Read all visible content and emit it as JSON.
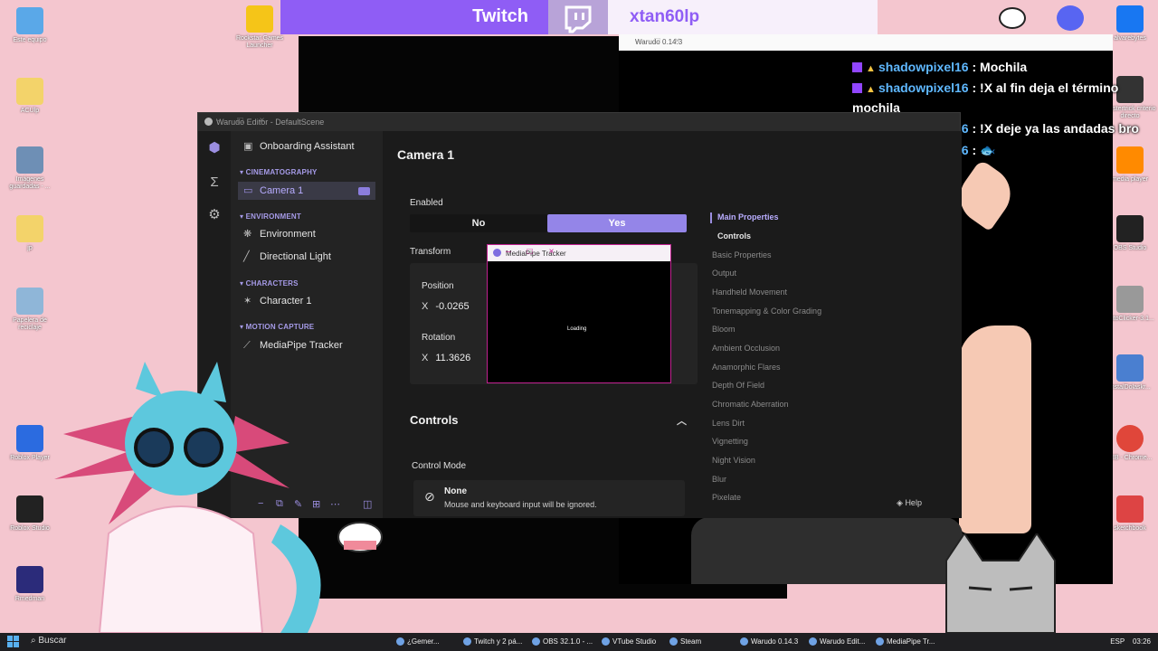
{
  "desktop": {
    "icons": [
      {
        "label": "Este equipo",
        "color": "#5aa8e8"
      },
      {
        "label": "ACUlp",
        "color": "#f3d36a"
      },
      {
        "label": "Imágenes guardadas - ...",
        "color": "#6e8fb5"
      },
      {
        "label": "jp",
        "color": "#f3d36a"
      },
      {
        "label": "Papelera de reciclaje",
        "color": "#8fb6d8"
      },
      {
        "label": "Roblox Player",
        "color": "#2b6be0"
      },
      {
        "label": "Roblox Studio",
        "color": "#222222"
      },
      {
        "label": "Rmedman",
        "color": "#2b2b7a"
      },
      {
        "label": "Rockstar Games Launcher",
        "color": "#f5c518"
      }
    ],
    "right_icons": [
      {
        "label": "alvarebytes",
        "color": "#1877f2"
      },
      {
        "label": "Mastertrick criterio directo",
        "color": "#333"
      },
      {
        "label": "media player",
        "color": "#ff8a00"
      },
      {
        "label": "OBS Studio",
        "color": "#222"
      },
      {
        "label": "AutoClicker-3.1...",
        "color": "#999"
      },
      {
        "label": "instalDolaskr...",
        "color": "#4a7fd0"
      },
      {
        "label": "GIB - Chrome...",
        "color": "#e0463a"
      },
      {
        "label": "sketchbook",
        "color": "#d44"
      }
    ]
  },
  "twitch_banner": {
    "brand": "Twitch",
    "username": "xtan60lp"
  },
  "chat": {
    "messages": [
      {
        "user": "shadowpixel16",
        "text": ": Mochila"
      },
      {
        "user": "shadowpixel16",
        "text": ": !X al fin deja el término mochila"
      },
      {
        "user": "shadowpixel16",
        "text": ": !X deje ya las andadas bro"
      },
      {
        "user": "shadowpixel16",
        "text": ": 🐟"
      }
    ]
  },
  "warudo_window": {
    "title": "Warudo 0.14.3"
  },
  "editor": {
    "title": "Warudo Editor - DefaultScene",
    "onboarding": "Onboarding Assistant",
    "sections": [
      {
        "header": "CINEMATOGRAPHY",
        "items": [
          "Camera 1"
        ]
      },
      {
        "header": "ENVIRONMENT",
        "items": [
          "Environment",
          "Directional Light"
        ]
      },
      {
        "header": "CHARACTERS",
        "items": [
          "Character 1"
        ]
      },
      {
        "header": "MOTION CAPTURE",
        "items": [
          "MediaPipe Tracker"
        ]
      }
    ],
    "page_title": "Camera 1",
    "enabled_label": "Enabled",
    "enabled_no": "No",
    "enabled_yes": "Yes",
    "transform_label": "Transform",
    "position_label": "Position",
    "position_x_axis": "X",
    "position_x": "-0.0265",
    "rotation_label": "Rotation",
    "rotation_x_axis": "X",
    "rotation_x": "11.3626",
    "controls_header": "Controls",
    "control_mode_label": "Control Mode",
    "control_mode_value": "None",
    "control_mode_desc": "Mouse and keyboard input will be ignored.",
    "properties": [
      "Main Properties",
      "Controls",
      "Basic Properties",
      "Output",
      "Handheld Movement",
      "Tonemapping & Color Grading",
      "Bloom",
      "Ambient Occlusion",
      "Anamorphic Flares",
      "Depth Of Field",
      "Chromatic Aberration",
      "Lens Dirt",
      "Vignetting",
      "Night Vision",
      "Blur",
      "Pixelate"
    ],
    "help": "Help"
  },
  "mediapipe": {
    "title": "MediaPipe Tracker",
    "loading": "Loading"
  },
  "taskbar": {
    "search": "Buscar",
    "tasks": [
      "¿Gemer...",
      "Twitch y 2 pá...",
      "OBS 32.1.0 - ...",
      "VTube Studio",
      "Steam",
      "Warudo 0.14.3",
      "Warudo Edit...",
      "MediaPipe Tr..."
    ],
    "language": "ESP",
    "time": "03:26"
  },
  "colors": {
    "accent": "#9485e8",
    "twitch": "#8f5df5",
    "desktop": "#f4c6cf"
  }
}
